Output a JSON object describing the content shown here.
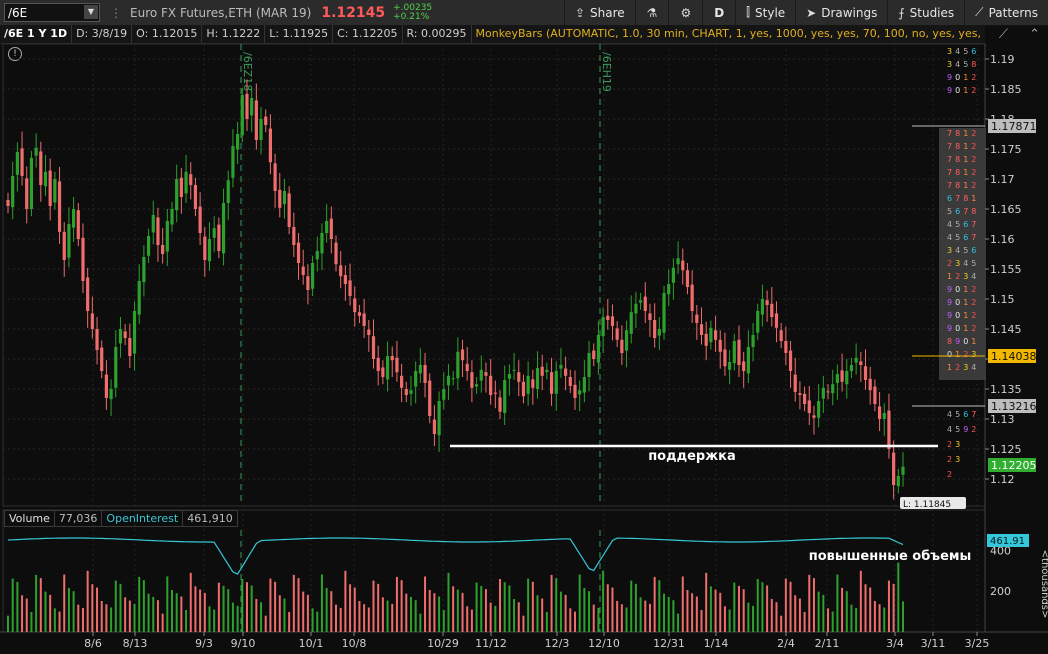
{
  "toolbar": {
    "symbol": "/6E",
    "instrument": "Euro FX Futures,ETH (MAR 19)",
    "last_price": "1.12145",
    "change_abs": "+.00235",
    "change_pct": "+0.21%",
    "share_label": "Share",
    "period_label": "D",
    "style_label": "Style",
    "drawings_label": "Drawings",
    "studies_label": "Studies",
    "patterns_label": "Patterns"
  },
  "inforow": {
    "symbol_period": "/6E 1 Y 1D",
    "date": "D: 3/8/19",
    "open": "O: 1.12015",
    "high": "H: 1.1222",
    "low": "L: 1.11925",
    "close": "C: 1.12205",
    "range": "R: 0.00295",
    "study": "MonkeyBars (AUTOMATIC, 1.0, 30 min, CHART, 1, yes, 1000, yes, yes, 70, 100, no, yes, yes, NONE, yes, yes,..."
  },
  "volume_header": {
    "volume_label": "Volume",
    "volume_value": "77,036",
    "oi_label": "OpenInterest",
    "oi_value": "461,910"
  },
  "annotations": {
    "support": "поддержка",
    "high_volume": "повышенные объемы"
  },
  "colors": {
    "up": "#2ea02e",
    "down": "#f06d6d",
    "open_interest": "#35c7d8",
    "background": "#0d0d0d"
  },
  "chart_data": {
    "type": "candlestick",
    "y_ticks": [
      "1.19",
      "1.185",
      "1.18",
      "1.175",
      "1.17",
      "1.165",
      "1.16",
      "1.155",
      "1.15",
      "1.145",
      "1.14",
      "1.135",
      "1.13",
      "1.125",
      "1.12"
    ],
    "ylim": [
      1.1155,
      1.192
    ],
    "x_ticks": [
      "8/6",
      "8/13",
      "9/3",
      "9/10",
      "10/1",
      "10/8",
      "10/29",
      "11/12",
      "12/3",
      "12/10",
      "12/31",
      "1/14",
      "2/4",
      "2/11",
      "3/4",
      "3/11",
      "3/25"
    ],
    "contract_markers": [
      "/6EZ18",
      "/6EH19"
    ],
    "price_labels": [
      {
        "value": "1.17871",
        "style": "grey"
      },
      {
        "value": "1.14038",
        "style": "gold"
      },
      {
        "value": "1.13216",
        "style": "grey"
      },
      {
        "value": "1.12205",
        "style": "green"
      },
      {
        "value": "L: 1.11845",
        "style": "tag"
      }
    ],
    "support_level": 1.1255,
    "closes": [
      1.1655,
      1.1705,
      1.1745,
      1.1705,
      1.165,
      1.1735,
      1.1752,
      1.169,
      1.1712,
      1.1655,
      1.17,
      1.1612,
      1.1565,
      1.1625,
      1.165,
      1.16,
      1.153,
      1.148,
      1.145,
      1.1415,
      1.138,
      1.1335,
      1.135,
      1.142,
      1.145,
      1.1435,
      1.1405,
      1.148,
      1.153,
      1.157,
      1.1605,
      1.164,
      1.159,
      1.1575,
      1.163,
      1.165,
      1.17,
      1.167,
      1.1712,
      1.169,
      1.165,
      1.161,
      1.1565,
      1.16,
      1.1618,
      1.158,
      1.166,
      1.1698,
      1.1755,
      1.1775,
      1.184,
      1.18,
      1.1835,
      1.1765,
      1.18,
      1.179,
      1.1728,
      1.168,
      1.1652,
      1.168,
      1.162,
      1.159,
      1.156,
      1.154,
      1.1515,
      1.156,
      1.158,
      1.161,
      1.163,
      1.16,
      1.1558,
      1.1538,
      1.1525,
      1.1505,
      1.1478,
      1.1472,
      1.1455,
      1.144,
      1.14,
      1.138,
      1.137,
      1.1405,
      1.1398,
      1.1378,
      1.1352,
      1.134,
      1.1348,
      1.138,
      1.139,
      1.136,
      1.1305,
      1.1275,
      1.133,
      1.135,
      1.1372,
      1.1368,
      1.1412,
      1.1398,
      1.138,
      1.1352,
      1.1358,
      1.1382,
      1.1372,
      1.134,
      1.1342,
      1.1312,
      1.1365,
      1.1375,
      1.1382,
      1.1362,
      1.1338,
      1.1372,
      1.1352,
      1.1385,
      1.1372,
      1.1382,
      1.1342,
      1.138,
      1.139,
      1.1372,
      1.1355,
      1.1335,
      1.1348,
      1.137,
      1.141,
      1.14,
      1.144,
      1.147,
      1.1465,
      1.1455,
      1.1432,
      1.141,
      1.1448,
      1.1478,
      1.1492,
      1.1498,
      1.148,
      1.1465,
      1.1435,
      1.145,
      1.151,
      1.1525,
      1.1552,
      1.1568,
      1.1548,
      1.152,
      1.148,
      1.146,
      1.144,
      1.1422,
      1.1452,
      1.1432,
      1.1412,
      1.1388,
      1.1395,
      1.143,
      1.139,
      1.138,
      1.142,
      1.144,
      1.148,
      1.15,
      1.149,
      1.147,
      1.1452,
      1.143,
      1.141,
      1.138,
      1.1345,
      1.134,
      1.1325,
      1.131,
      1.1302,
      1.133,
      1.1352,
      1.1345,
      1.1358,
      1.1375,
      1.1362,
      1.138,
      1.139,
      1.1402,
      1.139,
      1.1365,
      1.1348,
      1.1325,
      1.13,
      1.131,
      1.125,
      1.119,
      1.1205,
      1.12205
    ],
    "ohlc_note": "daily bars, 1 year",
    "volume_axis": {
      "label": "<thousands>",
      "ticks": [
        "400",
        "200"
      ],
      "max": 500
    },
    "volume_last": "461.91"
  },
  "monkeybars": {
    "top_rows": [
      "3 4 5 6",
      "3 4 5 8",
      "9 0 1 2",
      "9 0 1 2"
    ],
    "mid_rows": [
      "7 8 1 2",
      "7 8 1 2",
      "7 8 1 2",
      "7 8 1 2",
      "7 8 1 2",
      "6 7 8 1",
      "5 6 7 8",
      "4 5 6 7",
      "4 5 6 7",
      "3 4 5 6",
      "2 3 4 5",
      "1 2 3 4",
      "9 0 1 2",
      "9 0 1 2",
      "9 0 1 2",
      "9 0 1 2",
      "8 9 0 1",
      "0 1 2 3",
      "1 2 3 4"
    ],
    "bottom_rows": [
      "4 5 6 7",
      "4 5 9 2",
      "2 3",
      "2 3",
      "2"
    ]
  }
}
